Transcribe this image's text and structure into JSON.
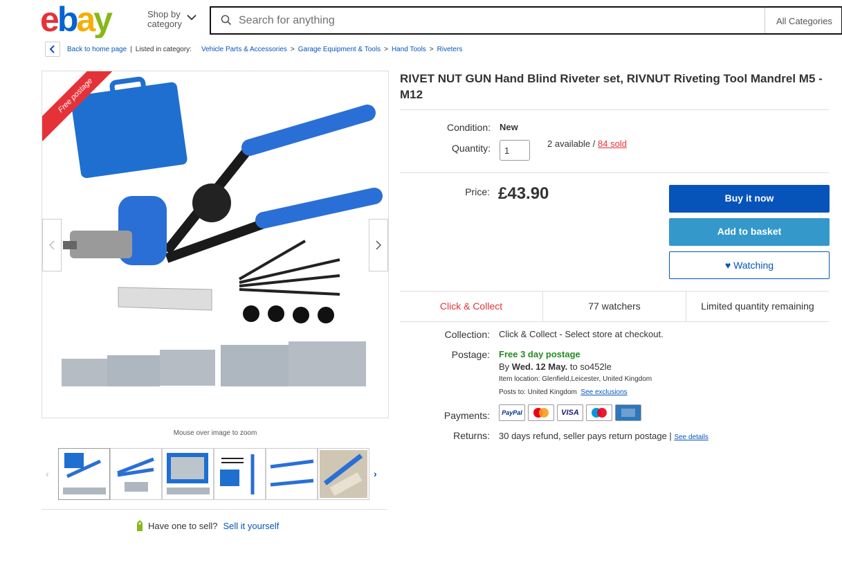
{
  "header": {
    "logo_text": "ebay",
    "shop_by_line1": "Shop by",
    "shop_by_line2": "category",
    "search_placeholder": "Search for anything",
    "category_select": "All Categories"
  },
  "breadcrumb": {
    "back_label": "Back to home page",
    "listed_label": "Listed in category:",
    "items": [
      "Vehicle Parts & Accessories",
      "Garage Equipment & Tools",
      "Hand Tools",
      "Riveters"
    ]
  },
  "gallery": {
    "badge": "Free postage",
    "zoom_hint": "Mouse over image to zoom",
    "thumbnail_count": 6
  },
  "sell": {
    "question": "Have one to sell?",
    "link": "Sell it yourself"
  },
  "item": {
    "title": "RIVET NUT GUN Hand Blind Riveter set, RIVNUT Riveting Tool Mandrel M5 - M12",
    "condition_label": "Condition:",
    "condition_value": "New",
    "quantity_label": "Quantity:",
    "quantity_value": "1",
    "available_text": "2 available /",
    "sold_text": "84 sold",
    "price_label": "Price:",
    "price": "£43.90",
    "buy_now": "Buy it now",
    "add_basket": "Add to basket",
    "watching": "Watching"
  },
  "stats": {
    "click_collect": "Click & Collect",
    "watchers": "77 watchers",
    "limited": "Limited quantity remaining"
  },
  "details": {
    "collection_label": "Collection:",
    "collection_value": "Click & Collect - Select store at checkout.",
    "postage_label": "Postage:",
    "postage_free": "Free 3 day postage",
    "postage_by_prefix": "By",
    "postage_date": "Wed. 12 May.",
    "postage_to": "to so452le",
    "item_location": "Item location:  Glenfield,Leicester, United Kingdom",
    "posts_to": "Posts to:  United Kingdom",
    "see_exclusions": "See exclusions",
    "payments_label": "Payments:",
    "payment_methods": [
      "PayPal",
      "Mastercard",
      "VISA",
      "Maestro",
      "AmEx"
    ],
    "returns_label": "Returns:",
    "returns_value": "30 days refund, seller pays return postage |",
    "see_details": "See details"
  },
  "colors": {
    "ebay_red": "#e53238",
    "ebay_blue": "#0064d2",
    "ebay_yellow": "#f5af02",
    "ebay_green": "#86b817",
    "buy_now": "#0654ba",
    "add_basket": "#3498ca"
  }
}
